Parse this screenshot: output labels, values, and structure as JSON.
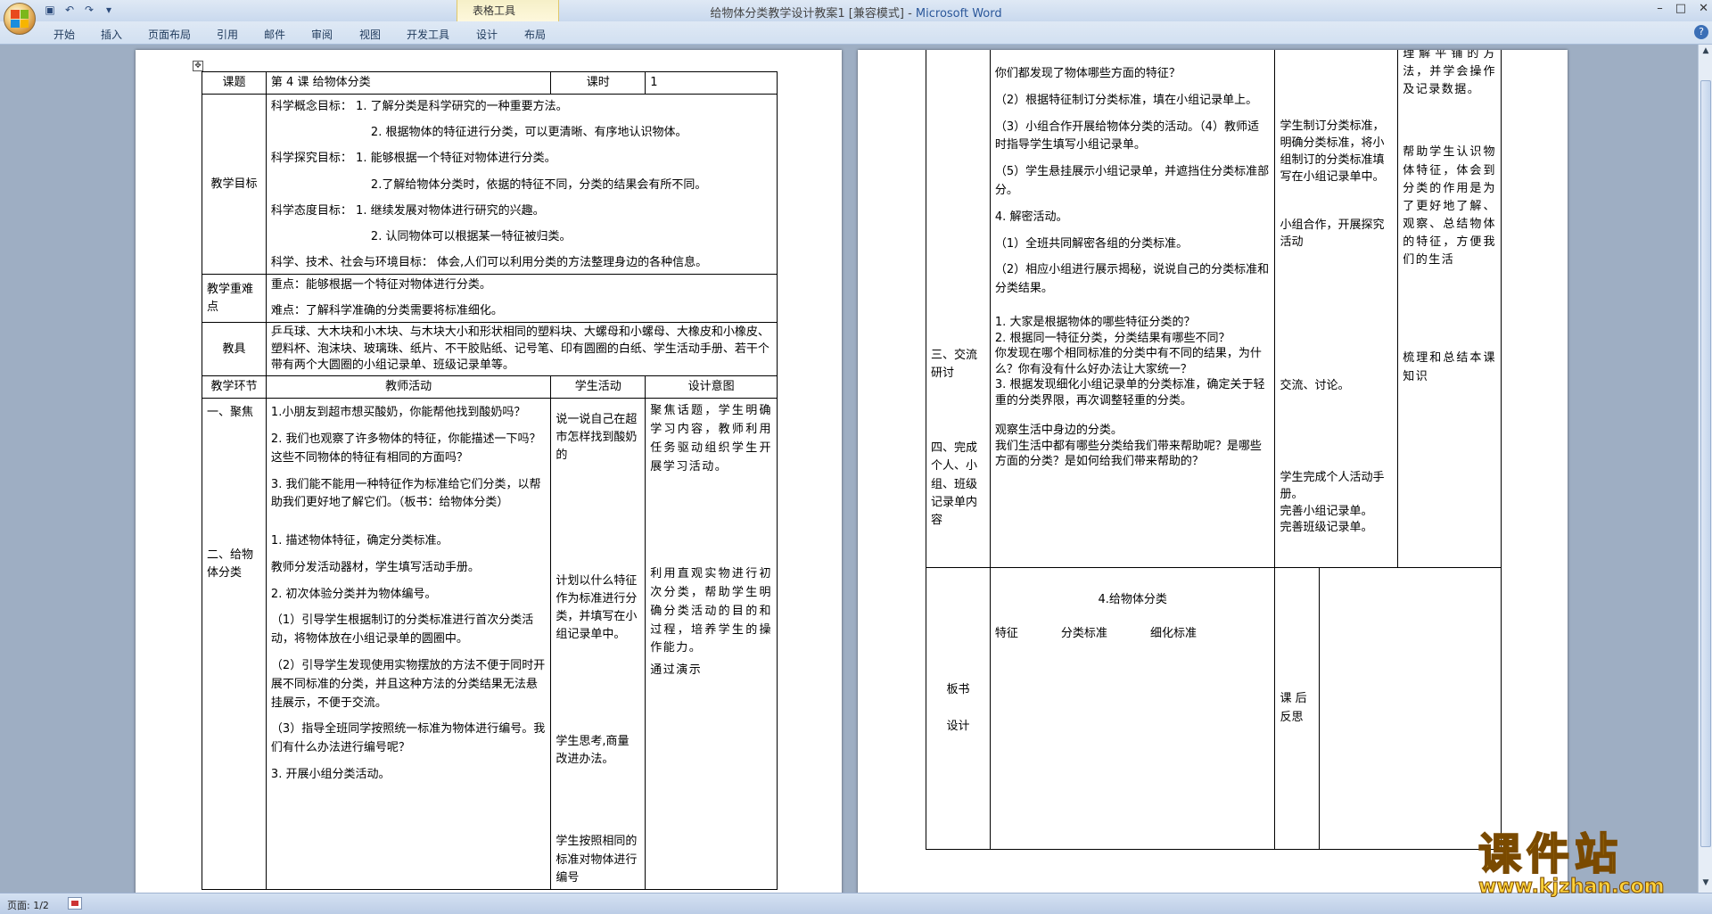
{
  "window": {
    "title": "给物体分类教学设计教案1 [兼容模式]",
    "app_name": "Microsoft Word",
    "context_group": "表格工具",
    "controls": [
      "–",
      "□",
      "✕"
    ]
  },
  "ribbon": {
    "tabs": [
      "开始",
      "插入",
      "页面布局",
      "引用",
      "邮件",
      "审阅",
      "视图",
      "开发工具",
      "设计",
      "布局"
    ]
  },
  "status": {
    "page": "页面: 1/2"
  },
  "watermark": {
    "name": "课件站",
    "url": "www.kjzhan.com"
  },
  "page1": {
    "r_topic": {
      "label": "课题",
      "value": "第 4 课   给物体分类",
      "hours_label": "课时",
      "hours": "1"
    },
    "r_goals": {
      "label": "教学目标",
      "lines": [
        "科学概念目标：   1. 了解分类是科学研究的一种重要方法。",
        "2. 根据物体的特征进行分类，可以更清晰、有序地认识物体。",
        "科学探究目标：   1. 能够根据一个特征对物体进行分类。",
        "2.了解给物体分类时，依据的特征不同，分类的结果会有所不同。",
        "科学态度目标：   1. 继续发展对物体进行研究的兴趣。",
        "2. 认同物体可以根据某一特征被归类。",
        "科学、技术、社会与环境目标：    体会,人们可以利用分类的方法整理身边的各种信息。"
      ]
    },
    "r_keys": {
      "label": "教学重难点",
      "lines": [
        "重点：能够根据一个特征对物体进行分类。",
        "难点：了解科学准确的分类需要将标准细化。"
      ]
    },
    "r_tools": {
      "label": "教具",
      "text": "乒乓球、大木块和小木块、与木块大小和形状相同的塑料块、大螺母和小螺母、大橡皮和小橡皮、塑料杯、泡沫块、玻璃珠、纸片、不干胶贴纸、记号笔、印有圆圈的白纸、学生活动手册、若干个带有两个大圆圈的小组记录单、班级记录单等。"
    },
    "r_head": {
      "stage": "教学环节",
      "teacher": "教师活动",
      "student": "学生活动",
      "intent": "设计意图"
    },
    "r_body": {
      "stages": [
        "一、聚焦",
        "二、给物体分类"
      ],
      "teacher": [
        "1.小朋友到超市想买酸奶，你能帮他找到酸奶吗？",
        "2. 我们也观察了许多物体的特征，你能描述一下吗？这些不同物体的特征有相同的方面吗？",
        "3. 我们能不能用一种特征作为标准给它们分类，以帮助我们更好地了解它们。（板书：给物体分类）",
        "1. 描述物体特征，确定分类标准。",
        "教师分发活动器材，学生填写活动手册。",
        "2. 初次体验分类并为物体编号。",
        "（1）引导学生根据制订的分类标准进行首次分类活动，将物体放在小组记录单的圆圈中。",
        "（2）引导学生发现使用实物摆放的方法不便于同时开展不同标准的分类，并且这种方法的分类结果无法悬挂展示，不便于交流。",
        "（3）指导全班同学按照统一标准为物体进行编号。我们有什么办法进行编号呢？",
        "3. 开展小组分类活动。"
      ],
      "student": [
        "说一说自己在超市怎样找到酸奶的",
        "计划以什么特征作为标准进行分类，并填写在小组记录单中。",
        "学生思考,商量改进办法。",
        "学生按照相同的标准对物体进行编号"
      ],
      "intent": [
        "聚焦话题，学生明确学习内容，教师利用任务驱动组织学生开展学习活动。",
        "利用直观实物进行初次分类，帮助学生明确分类活动的目的和过程，培养学生的操作能力。",
        "通过演示"
      ]
    }
  },
  "page2": {
    "teacher": [
      "你们都发现了物体哪些方面的特征？",
      "（2）根据特征制订分类标准，填在小组记录单上。",
      "（3）小组合作开展给物体分类的活动。（4）教师适时指导学生填写小组记录单。",
      "（5）学生悬挂展示小组记录单，并遮挡住分类标准部分。",
      "4. 解密活动。",
      "（1）全班共同解密各组的分类标准。",
      "（2）相应小组进行展示揭秘，说说自己的分类标准和分类结果。",
      "1. 大家是根据物体的哪些特征分类的？",
      "2. 根据同一特征分类，分类结果有哪些不同？",
      "你发现在哪个相同标准的分类中有不同的结果，为什么？你有没有什么好办法让大家统一？",
      "3. 根据发现细化小组记录单的分类标准，确定关于轻重的分类界限，再次调整轻重的分类。",
      "观察生活中身边的分类。",
      "我们生活中都有哪些分类给我们带来帮助呢？是哪些方面的分类？是如何给我们带来帮助的？"
    ],
    "stages": [
      "三、交流研讨",
      "四、完成个人、小组、班级记录单内容"
    ],
    "student": [
      "学生制订分类标准，明确分类标准，将小组制订的分类标准填写在小组记录单中。",
      "小组合作，开展探究活动",
      "交流、讨论。",
      "学生完成个人活动手册。",
      "完善小组记录单。",
      "完善班级记录单。"
    ],
    "intent": [
      "理解平铺的方法，并学会操作及记录数据。",
      "帮助学生认识物体特征，体会到分类的作用是为了更好地了解、观察、总结物体的特征，方便我们的生活",
      "梳理和总结本课知识"
    ],
    "board": {
      "label1": "板书",
      "label2": "设计",
      "title": "4.给物体分类",
      "cols": [
        "特征",
        "分类标准",
        "细化标准"
      ],
      "reflect": "课 后反思"
    }
  }
}
